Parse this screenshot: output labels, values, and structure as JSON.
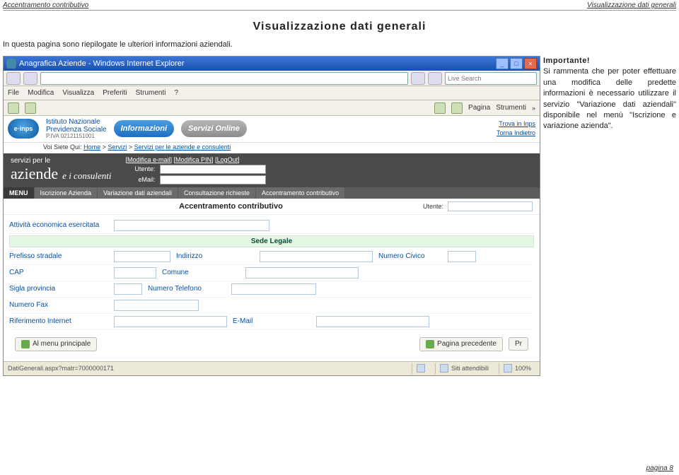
{
  "header": {
    "left": "Accentramento contributivo",
    "right": "Visualizzazione dati generali"
  },
  "title": "Visualizzazione dati generali",
  "intro": "In questa pagina sono riepilogate le ulteriori informazioni aziendali.",
  "note": {
    "heading": "Importante!",
    "body": "Si rammenta che per poter effettuare una modifica delle predette informazioni è necessario utilizzare il servizio \"Variazione dati aziendali\" disponibile nel menù \"Iscrizione e variazione azienda\"."
  },
  "browser": {
    "window_title": "Anagrafica Aziende - Windows Internet Explorer",
    "search_placeholder": "Live Search",
    "menus": [
      "File",
      "Modifica",
      "Visualizza",
      "Preferiti",
      "Strumenti",
      "?"
    ],
    "toolbar_labels": {
      "page": "Pagina",
      "tools": "Strumenti"
    },
    "status": {
      "url": "DatiGenerali.aspx?matr=7000000171",
      "trusted": "Siti attendibili",
      "zoom": "100%"
    }
  },
  "site": {
    "logo_text": "e·inps",
    "org_line1": "Istituto Nazionale",
    "org_line2": "Previdenza Sociale",
    "piva": "P.IVA 02121151001",
    "tab_info": "Informazioni",
    "tab_serv": "Servizi Online",
    "corner_trova": "Trova in Inps",
    "corner_back": "Torna Indietro",
    "breadcrumb_prefix": "Voi Siete Qui:",
    "breadcrumb": [
      "Home",
      "Servizi",
      "Servizi per le aziende e consulenti"
    ],
    "dark": {
      "svc_line1": "servizi per le",
      "aziende": "aziende",
      "cons": "e i consulenti",
      "links": [
        "[Modifica e-mail]",
        "[Modifica PIN]",
        "[LogOut]"
      ],
      "user_label": "Utente:",
      "email_label": "eMail:"
    },
    "menu_tabs": [
      "MENU",
      "Iscrizione Azienda",
      "Variazione dati aziendali",
      "Consultazione richieste",
      "Accentramento contributivo"
    ],
    "subheader": {
      "title": "Accentramento contributivo",
      "user_label": "Utente:"
    }
  },
  "form": {
    "attivita": "Attività economica esercitata",
    "sede_legale": "Sede Legale",
    "prefisso": "Prefisso stradale",
    "indirizzo": "Indirizzo",
    "civico": "Numero Civico",
    "cap": "CAP",
    "comune": "Comune",
    "sigla": "Sigla provincia",
    "telefono": "Numero Telefono",
    "fax": "Numero Fax",
    "riferimento": "Riferimento Internet",
    "email": "E-Mail"
  },
  "buttons": {
    "menu": "Al menu principale",
    "prev": "Pagina precedente",
    "next": "Pr"
  },
  "footer": "pagina 8"
}
